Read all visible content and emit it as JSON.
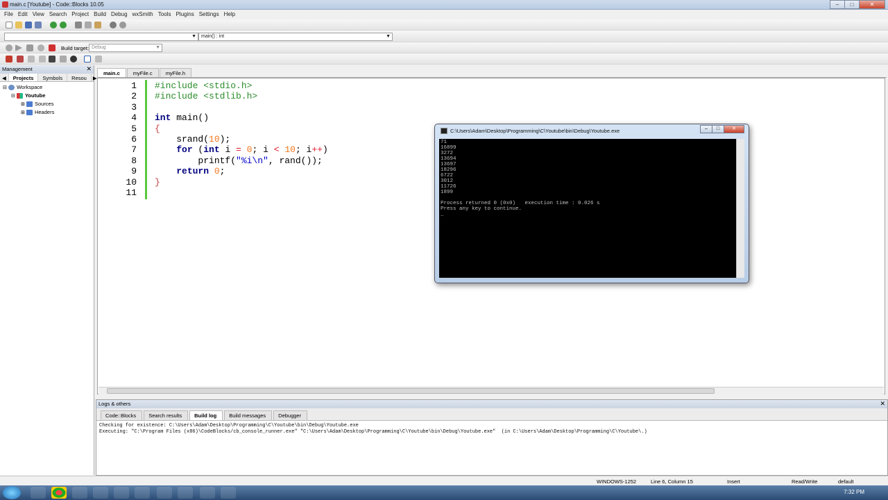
{
  "window": {
    "title": "main.c [Youtube] - Code::Blocks 10.05"
  },
  "menu": [
    "File",
    "Edit",
    "View",
    "Search",
    "Project",
    "Build",
    "Debug",
    "wxSmith",
    "Tools",
    "Plugins",
    "Settings",
    "Help"
  ],
  "toolbar": {
    "scope_combo": "",
    "function_combo": "main() : int",
    "build_target_label": "Build target:",
    "build_target_value": "Debug"
  },
  "management": {
    "title": "Management",
    "tabs": [
      "Projects",
      "Symbols",
      "Resou"
    ],
    "tree": {
      "workspace": "Workspace",
      "project": "Youtube",
      "sources": "Sources",
      "headers": "Headers"
    }
  },
  "editor": {
    "tabs": [
      "main.c",
      "myFile.c",
      "myFile.h"
    ],
    "line_numbers": [
      "1",
      "2",
      "3",
      "4",
      "5",
      "6",
      "7",
      "8",
      "9",
      "10",
      "11"
    ],
    "lines": [
      "#include <stdio.h>",
      "#include <stdlib.h>",
      "",
      "int main()",
      "{",
      "    srand(10);",
      "    for (int i = 0; i < 10; i++)",
      "        printf(\"%i\\n\", rand());",
      "    return 0;",
      "}",
      ""
    ]
  },
  "console": {
    "title": "C:\\Users\\Adam\\Desktop\\Programming\\C\\Youtube\\bin\\Debug\\Youtube.exe",
    "output": "71\n16899\n3272\n13694\n13697\n18296\n6722\n3012\n11726\n1899\n\nProcess returned 0 (0x0)   execution time : 0.026 s\nPress any key to continue.\n_"
  },
  "logs": {
    "title": "Logs & others",
    "tabs": [
      "Code::Blocks",
      "Search results",
      "Build log",
      "Build messages",
      "Debugger"
    ],
    "active_tab": "Build log",
    "text": "Checking for existence: C:\\Users\\Adam\\Desktop\\Programming\\C\\Youtube\\bin\\Debug\\Youtube.exe\nExecuting: \"C:\\Program Files (x86)\\CodeBlocks/cb_console_runner.exe\" \"C:\\Users\\Adam\\Desktop\\Programming\\C\\Youtube\\bin\\Debug\\Youtube.exe\"  (in C:\\Users\\Adam\\Desktop\\Programming\\C\\Youtube\\.)"
  },
  "status": {
    "encoding": "WINDOWS-1252",
    "position": "Line 6, Column 15",
    "mode": "Insert",
    "access": "Read/Write",
    "profile": "default"
  },
  "taskbar": {
    "clock": "7:32 PM"
  }
}
